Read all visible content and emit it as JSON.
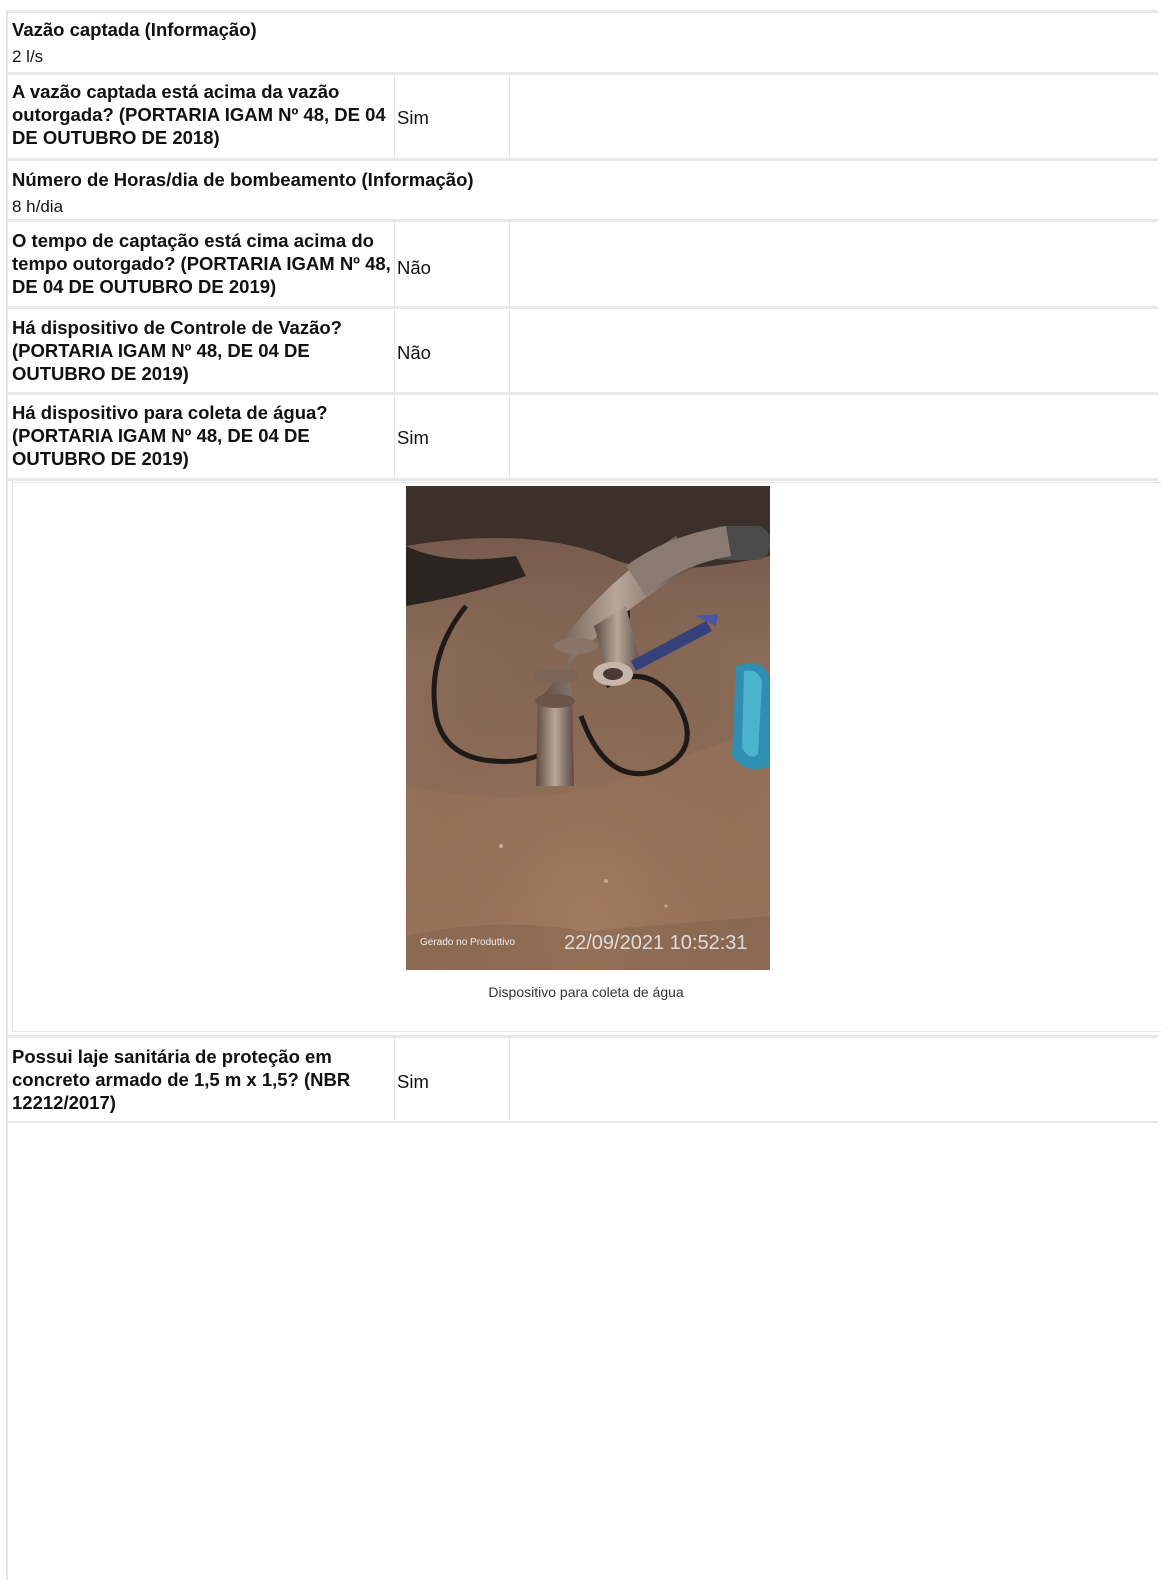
{
  "rows": [
    {
      "label": "Vazão captada (Informação)",
      "value": "2 l/s"
    },
    {
      "label": "A vazão captada está acima da vazão outorgada? (PORTARIA IGAM Nº 48, DE 04 DE OUTUBRO DE 2018)",
      "value": "Sim"
    },
    {
      "label": "Número de Horas/dia de bombeamento (Informação)",
      "value": "8 h/dia"
    },
    {
      "label": "O tempo de captação está cima acima do tempo outorgado? (PORTARIA IGAM Nº 48, DE 04 DE OUTUBRO DE 2019)",
      "value": "Não"
    },
    {
      "label": "Há dispositivo de Controle de Vazão? (PORTARIA IGAM Nº 48, DE 04 DE OUTUBRO DE 2019)",
      "value": "Não"
    },
    {
      "label": "Há dispositivo para coleta de água? (PORTARIA IGAM Nº 48, DE 04 DE OUTUBRO DE 2019)",
      "value": "Sim"
    },
    {
      "label": "Possui laje sanitária de proteção em concreto armado de 1,5 m x 1,5? (NBR 12212/2017)",
      "value": "Sim"
    }
  ],
  "photo": {
    "watermark_app": "Gerado no Produttivo",
    "timestamp": "22/09/2021 10:52:31",
    "caption": "Dispositivo para coleta de água"
  }
}
